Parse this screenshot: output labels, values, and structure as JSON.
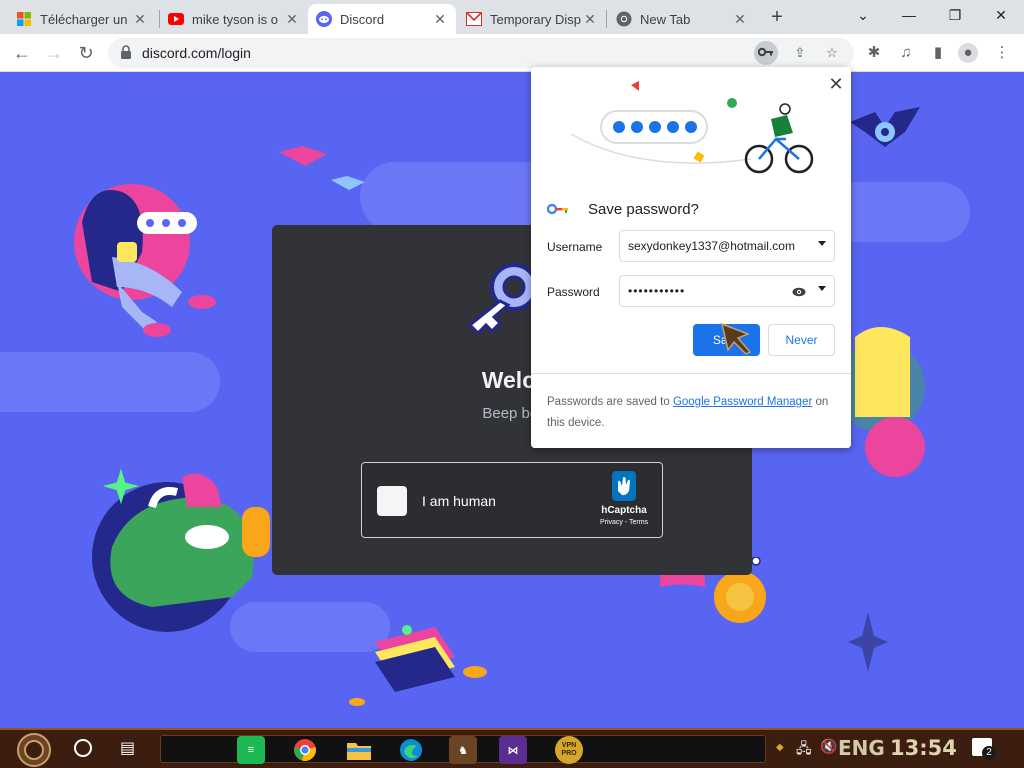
{
  "tabs": [
    {
      "title": "Télécharger un",
      "icon": "windows-icon"
    },
    {
      "title": "mike tyson is o",
      "icon": "youtube-icon"
    },
    {
      "title": "Discord",
      "icon": "discord-icon"
    },
    {
      "title": "Temporary Disp",
      "icon": "mail-icon"
    },
    {
      "title": "New Tab",
      "icon": "chrome-icon"
    }
  ],
  "toolbar": {
    "url": "discord.com/login"
  },
  "login": {
    "welcome": "Welcome",
    "subtitle": "Beep boop. Bo"
  },
  "captcha": {
    "label": "I am human",
    "brand": "hCaptcha",
    "terms": "Privacy - Terms"
  },
  "save_password": {
    "title": "Save password?",
    "username_label": "Username",
    "username_value": "sexydonkey1337@hotmail.com",
    "password_label": "Password",
    "password_value": "•••••••••••",
    "save_label": "Save",
    "never_label": "Never",
    "footer_prefix": "Passwords are saved to",
    "footer_link": "Google Password Manager",
    "footer_suffix": "on this device."
  },
  "taskbar": {
    "language": "ENG",
    "clock": "13:54",
    "notification_count": "2",
    "vpn_label": "VPN PRO"
  },
  "colors": {
    "discord_blurple": "#5865f2",
    "card_bg": "#313338",
    "google_blue": "#1a73e8"
  }
}
